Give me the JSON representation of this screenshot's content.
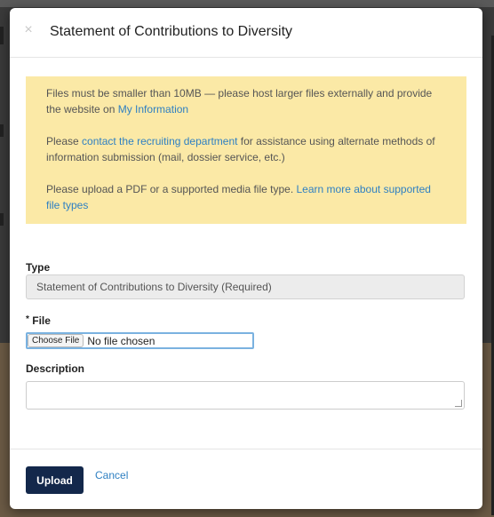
{
  "modal": {
    "title": "Statement of Contributions to Diversity",
    "close_glyph": "×"
  },
  "notice": {
    "line1_text": "Files must be smaller than 10MB — please host larger files externally and provide the website on ",
    "line1_link": "My Information",
    "line2_pre": "Please ",
    "line2_link": "contact the recruiting department",
    "line2_post": " for assistance using alternate methods of information submission (mail, dossier service, etc.)",
    "line3_pre": "Please upload a PDF or a supported media file type. ",
    "line3_link": "Learn more about supported file types",
    "background_color": "#fbe9a6",
    "link_color": "#2f80c2"
  },
  "form": {
    "type_label": "Type",
    "type_value": "Statement of Contributions to Diversity (Required)",
    "file_required_mark": "*",
    "file_label": "File",
    "choose_file_label": "Choose File",
    "no_file_text": "No file chosen",
    "description_label": "Description",
    "description_value": ""
  },
  "footer": {
    "upload_label": "Upload",
    "cancel_label": "Cancel",
    "upload_color": "#13284b"
  },
  "icons": {
    "close": "close-icon",
    "resize": "resize-grip-icon"
  }
}
